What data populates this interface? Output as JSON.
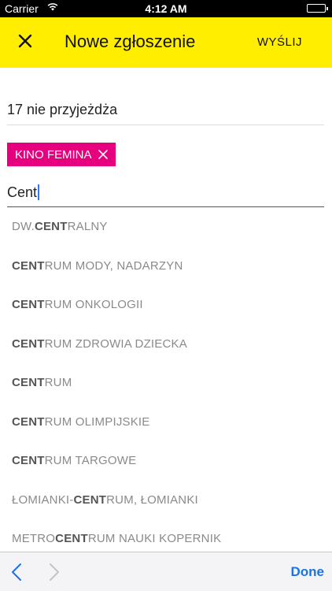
{
  "status_bar": {
    "carrier": "Carrier",
    "time": "4:12 AM"
  },
  "nav": {
    "title": "Nowe zgłoszenie",
    "send_label": "WYŚLIJ"
  },
  "form": {
    "subject_value": "17 nie przyjeżdża",
    "tag_label": "KINO FEMINA",
    "search_value": "Cent"
  },
  "suggestions": [
    {
      "before": "DW.",
      "match": "CENT",
      "after": "RALNY"
    },
    {
      "before": "",
      "match": "CENT",
      "after": "RUM MODY, NADARZYN"
    },
    {
      "before": "",
      "match": "CENT",
      "after": "RUM ONKOLOGII"
    },
    {
      "before": "",
      "match": "CENT",
      "after": "RUM ZDROWIA DZIECKA"
    },
    {
      "before": "",
      "match": "CENT",
      "after": "RUM"
    },
    {
      "before": "",
      "match": "CENT",
      "after": "RUM OLIMPIJSKIE"
    },
    {
      "before": "",
      "match": "CENT",
      "after": "RUM TARGOWE"
    },
    {
      "before": "ŁOMIANKI-",
      "match": "CENT",
      "after": "RUM, ŁOMIANKI"
    },
    {
      "before": "METRO ",
      "match": "CENT",
      "after": "RUM NAUKI KOPERNIK"
    }
  ],
  "toolbar": {
    "done_label": "Done"
  },
  "colors": {
    "nav_background": "#ffee00",
    "tag_background": "#e6007e",
    "done_text": "#1a73e8"
  },
  "icons": {
    "close": "close-icon",
    "tag_remove": "close-icon",
    "previous": "chevron-left-icon",
    "next": "chevron-right-icon",
    "wifi": "wifi-icon",
    "battery": "battery-icon"
  }
}
